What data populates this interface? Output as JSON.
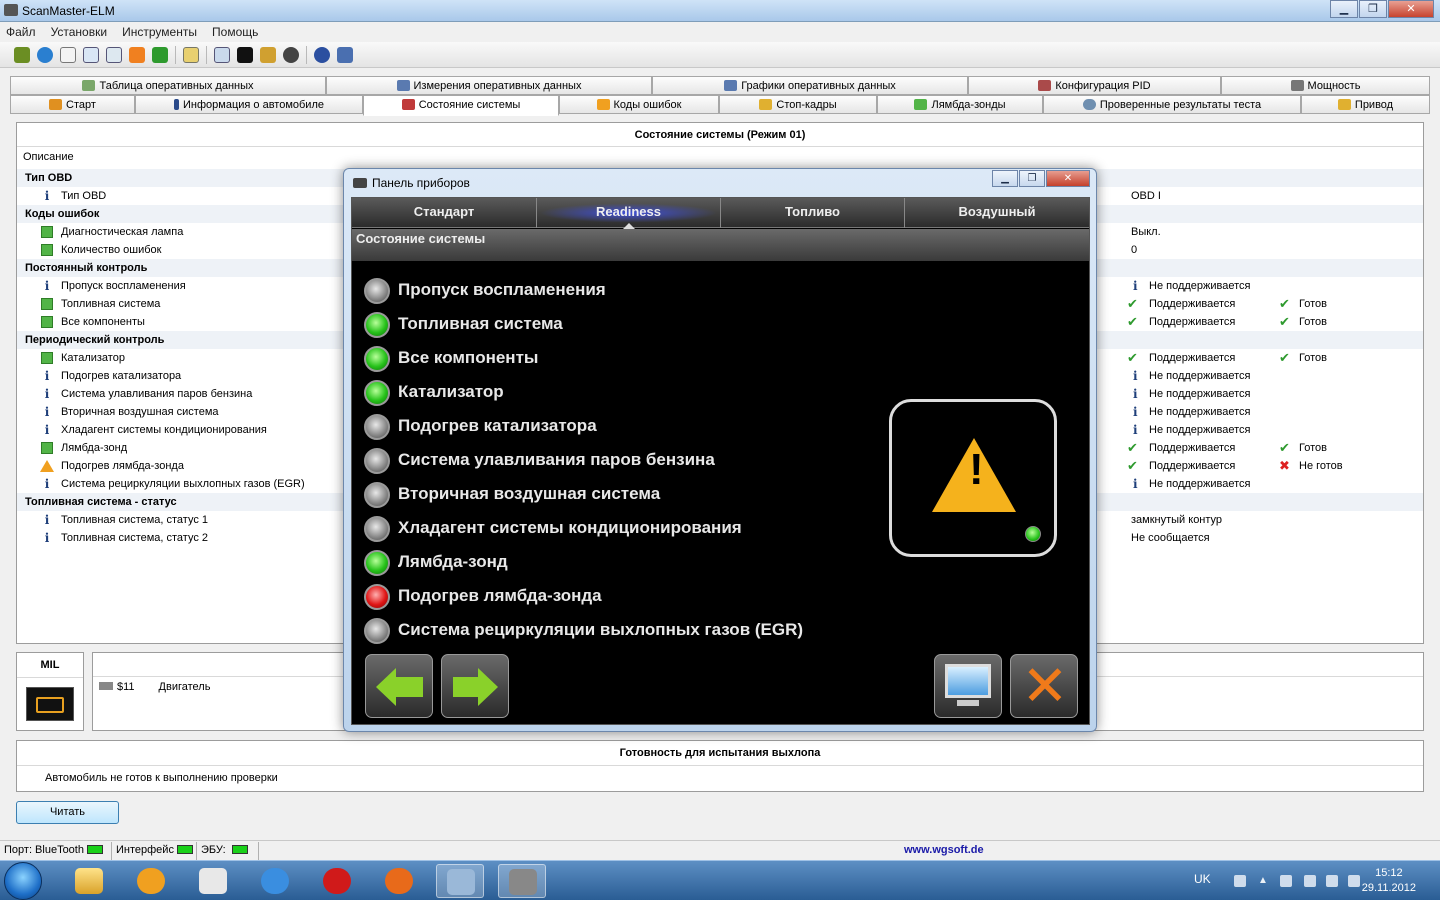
{
  "window": {
    "title": "ScanMaster-ELM",
    "min": "▁",
    "max": "❐",
    "close": "✕"
  },
  "menu": [
    "Файл",
    "Установки",
    "Инструменты",
    "Помощь"
  ],
  "tabs_top": [
    {
      "label": "Таблица оперативных данных"
    },
    {
      "label": "Измерения оперативных данных"
    },
    {
      "label": "Графики оперативных данных"
    },
    {
      "label": "Конфигурация PID"
    },
    {
      "label": "Мощность"
    }
  ],
  "tabs_bottom": [
    {
      "label": "Старт"
    },
    {
      "label": "Информация о автомобиле"
    },
    {
      "label": "Состояние системы"
    },
    {
      "label": "Коды ошибок"
    },
    {
      "label": "Стоп-кадры"
    },
    {
      "label": "Лямбда-зонды"
    },
    {
      "label": "Проверенные результаты теста"
    },
    {
      "label": "Привод"
    }
  ],
  "status_panel": {
    "title": "Состояние системы (Режим 01)",
    "column_description": "Описание",
    "rows": [
      {
        "kind": "group",
        "label": "Тип OBD"
      },
      {
        "kind": "item",
        "icon": "info",
        "label": "Тип OBD",
        "value": "OBD I"
      },
      {
        "kind": "group",
        "label": "Коды ошибок"
      },
      {
        "kind": "item",
        "icon": "green",
        "label": "Диагностическая лампа",
        "value": "Выкл."
      },
      {
        "kind": "item",
        "icon": "green",
        "label": "Количество ошибок",
        "value": "0"
      },
      {
        "kind": "group",
        "label": "Постоянный контроль"
      },
      {
        "kind": "item",
        "icon": "info",
        "label": "Пропуск воспламенения",
        "support_icon": "info",
        "value": "Не поддерживается"
      },
      {
        "kind": "item",
        "icon": "green",
        "label": "Топливная система",
        "support_icon": "check",
        "value": "Поддерживается",
        "status_icon": "check",
        "status": "Готов"
      },
      {
        "kind": "item",
        "icon": "green",
        "label": "Все компоненты",
        "support_icon": "check",
        "value": "Поддерживается",
        "status_icon": "check",
        "status": "Готов"
      },
      {
        "kind": "group",
        "label": "Периодический контроль"
      },
      {
        "kind": "item",
        "icon": "green",
        "label": "Катализатор",
        "support_icon": "check",
        "value": "Поддерживается",
        "status_icon": "check",
        "status": "Готов"
      },
      {
        "kind": "item",
        "icon": "info",
        "label": "Подогрев катализатора",
        "support_icon": "info",
        "value": "Не поддерживается"
      },
      {
        "kind": "item",
        "icon": "info",
        "label": "Система улавливания паров бензина",
        "support_icon": "info",
        "value": "Не поддерживается"
      },
      {
        "kind": "item",
        "icon": "info",
        "label": "Вторичная воздушная система",
        "support_icon": "info",
        "value": "Не поддерживается"
      },
      {
        "kind": "item",
        "icon": "info",
        "label": "Хладагент системы кондиционирования",
        "support_icon": "info",
        "value": "Не поддерживается"
      },
      {
        "kind": "item",
        "icon": "green",
        "label": "Лямбда-зонд",
        "support_icon": "check",
        "value": "Поддерживается",
        "status_icon": "check",
        "status": "Готов"
      },
      {
        "kind": "item",
        "icon": "warn",
        "label": "Подогрев лямбда-зонда",
        "support_icon": "check",
        "value": "Поддерживается",
        "status_icon": "cross",
        "status": "Не готов"
      },
      {
        "kind": "item",
        "icon": "info",
        "label": "Система рециркуляции выхлопных газов (EGR)",
        "support_icon": "info",
        "value": "Не поддерживается"
      },
      {
        "kind": "group",
        "label": "Топливная система - статус"
      },
      {
        "kind": "item",
        "icon": "info",
        "label": "Топливная система, статус 1",
        "value": "замкнутый контур"
      },
      {
        "kind": "item",
        "icon": "info",
        "label": "Топливная система, статус 2",
        "value": "Не сообщается"
      }
    ]
  },
  "mil": {
    "title": "MIL",
    "dtc_code": "$11",
    "dtc_desc": "Двигатель"
  },
  "readiness": {
    "title": "Готовность для испытания выхлопа",
    "text": "Автомобиль не готов к выполнению проверки"
  },
  "read_button": "Читать",
  "statusbar": {
    "port": "Порт: BlueTooth",
    "interface": "Интерфейс",
    "ecu": "ЭБУ:",
    "link": "www.wgsoft.de"
  },
  "dashboard": {
    "title": "Панель приборов",
    "tabs": [
      "Стандарт",
      "Readiness",
      "Топливо",
      "Воздушный"
    ],
    "active_tab": 1,
    "subtitle": "Состояние системы",
    "items": [
      {
        "label": "Пропуск воспламенения",
        "state": "na"
      },
      {
        "label": "Топливная система",
        "state": "ok"
      },
      {
        "label": "Все компоненты",
        "state": "ok"
      },
      {
        "label": "Катализатор",
        "state": "ok"
      },
      {
        "label": "Подогрев катализатора",
        "state": "na"
      },
      {
        "label": "Система улавливания паров бензина",
        "state": "na"
      },
      {
        "label": "Вторичная воздушная система",
        "state": "na"
      },
      {
        "label": "Хладагент системы кондиционирования",
        "state": "na"
      },
      {
        "label": "Лямбда-зонд",
        "state": "ok"
      },
      {
        "label": "Подогрев лямбда-зонда",
        "state": "bad"
      },
      {
        "label": "Система рециркуляции выхлопных газов (EGR)",
        "state": "na"
      }
    ]
  },
  "tray": {
    "lang": "UK",
    "time": "15:12",
    "date": "29.11.2012"
  }
}
